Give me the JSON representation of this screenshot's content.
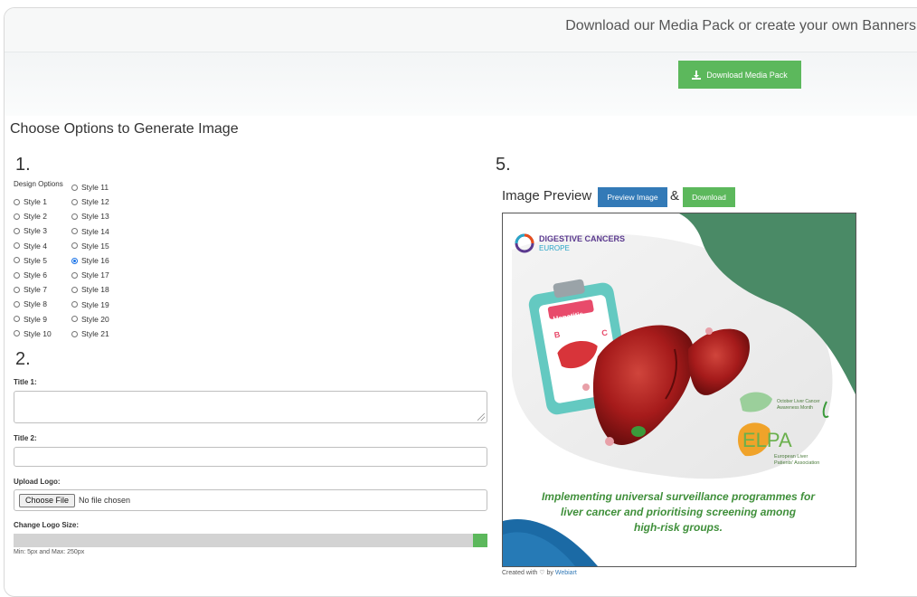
{
  "header": {
    "title": "Download our Media Pack or create your own Banners"
  },
  "media_button": {
    "label": "Download Media Pack",
    "icon": "download-icon",
    "color": "#5cb85c"
  },
  "form": {
    "heading": "Choose Options to Generate Image",
    "step1": "1.",
    "step2": "2.",
    "step5": "5.",
    "design_options_label": "Design Options",
    "styles_col1": [
      "Style 1",
      "Style 2",
      "Style 3",
      "Style 4",
      "Style 5",
      "Style 6",
      "Style 7",
      "Style 8",
      "Style 9",
      "Style 10"
    ],
    "styles_col2": [
      "Style 11",
      "Style 12",
      "Style 13",
      "Style 14",
      "Style 15",
      "Style 16",
      "Style 17",
      "Style 18",
      "Style 19",
      "Style 20",
      "Style 21"
    ],
    "selected_style": "Style 16",
    "title1_label": "Title 1:",
    "title1_value": "",
    "title2_label": "Title 2:",
    "title2_value": "",
    "upload_logo_label": "Upload Logo:",
    "choose_file_label": "Choose File",
    "file_status": "No file chosen",
    "logo_size_label": "Change Logo Size:",
    "logo_size_hint": "Min: 5px and Max: 250px"
  },
  "preview": {
    "label": "Image Preview",
    "preview_button": "Preview Image",
    "ampersand": "&",
    "download_button": "Download",
    "banner": {
      "org_line1": "DIGESTIVE CANCERS",
      "org_line2": "EUROPE",
      "clipboard_text": "Hepatitis",
      "clipboard_letter_b": "B",
      "clipboard_letter_c": "C",
      "awareness_line1": "October Liver Cancer",
      "awareness_line2": "Awareness Month",
      "elpa": "ELPA",
      "elpa_line1": "European Liver",
      "elpa_line2": "Patients' Association",
      "message_line1": "Implementing universal surveillance programmes for",
      "message_line2": "liver cancer and prioritising screening among",
      "message_line3": "high-risk groups."
    },
    "credit_prefix": "Created with",
    "credit_by": "by",
    "credit_link": "Webiart"
  },
  "colors": {
    "primary": "#337ab7",
    "success": "#5cb85c",
    "banner_green": "#4a8a66",
    "banner_blue": "#1b6aa5",
    "message_green": "#3f8f3a",
    "liver_red": "#a61b1b"
  }
}
